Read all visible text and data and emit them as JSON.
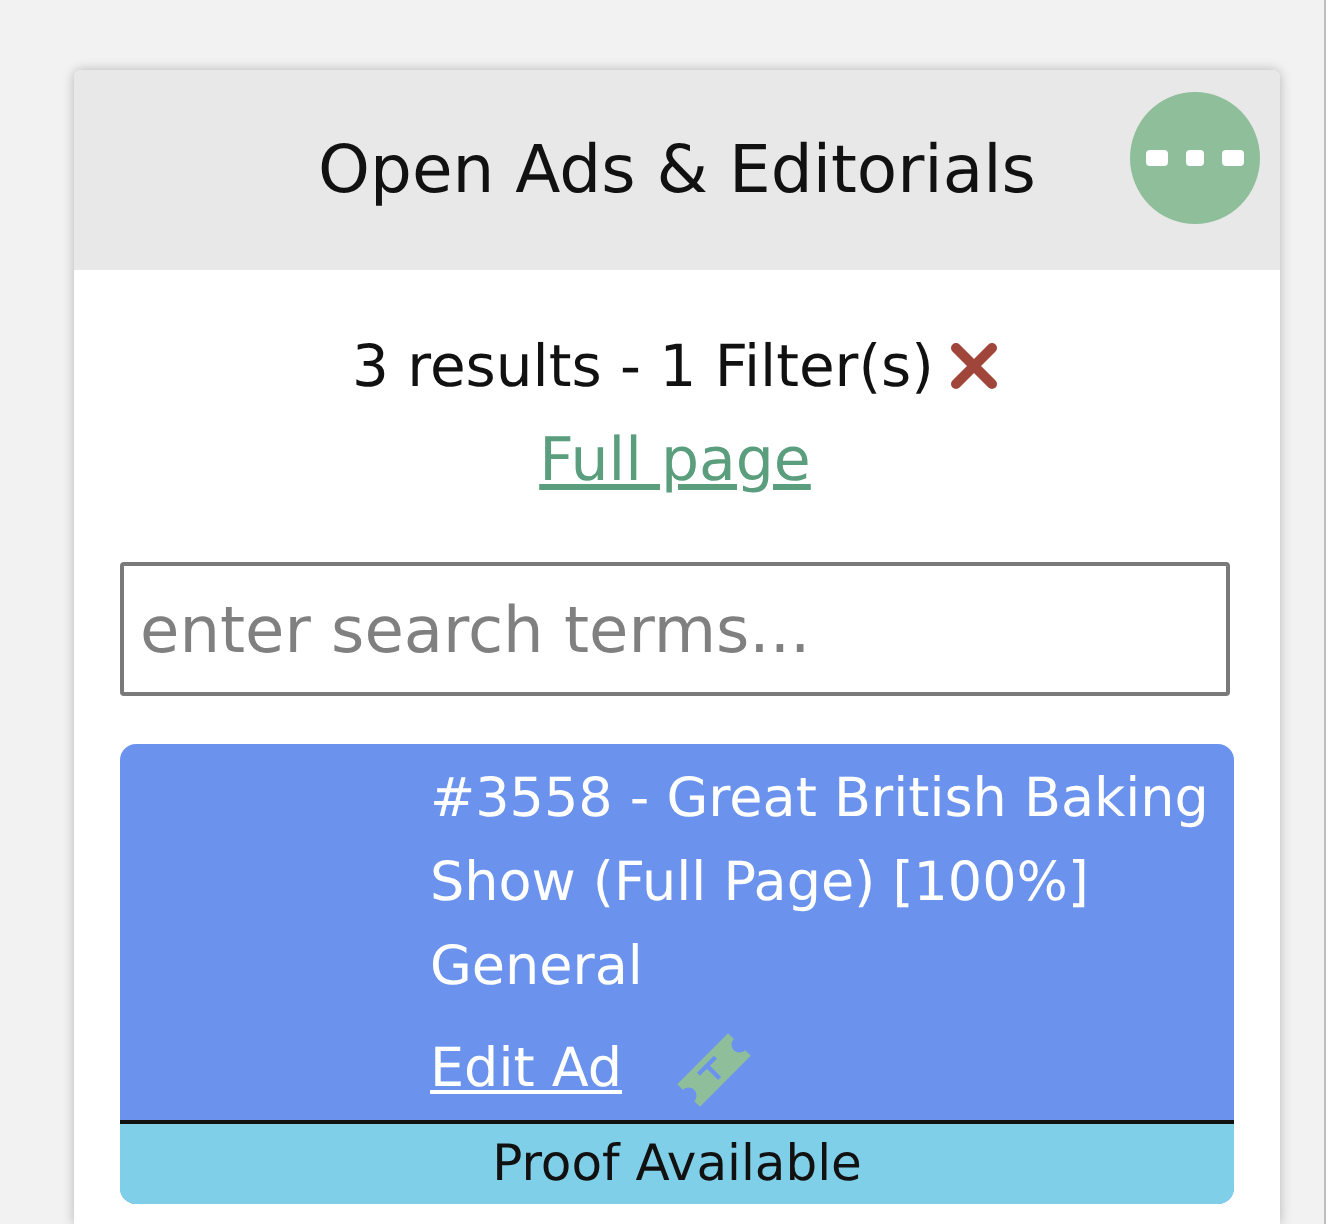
{
  "panel": {
    "title": "Open Ads & Editorials"
  },
  "summary": {
    "results": "3 results - 1 Filter(s)",
    "link": "Full page"
  },
  "search": {
    "placeholder": "enter search terms..."
  },
  "items": [
    {
      "title": "#3558 - Great British Baking Show (Full Page) [100%]",
      "section": "General",
      "action": "Edit Ad",
      "status": "Proof Available"
    }
  ]
}
